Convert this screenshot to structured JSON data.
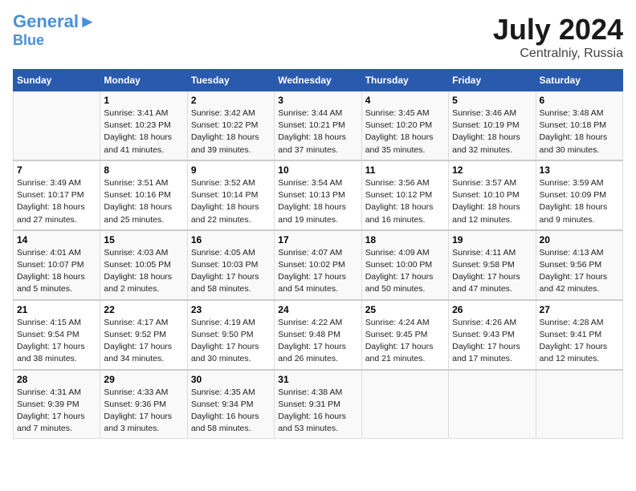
{
  "header": {
    "logo_line1": "General",
    "logo_line2": "Blue",
    "month_year": "July 2024",
    "location": "Centralniy, Russia"
  },
  "days_of_week": [
    "Sunday",
    "Monday",
    "Tuesday",
    "Wednesday",
    "Thursday",
    "Friday",
    "Saturday"
  ],
  "weeks": [
    [
      {
        "day": "",
        "info": ""
      },
      {
        "day": "1",
        "info": "Sunrise: 3:41 AM\nSunset: 10:23 PM\nDaylight: 18 hours\nand 41 minutes."
      },
      {
        "day": "2",
        "info": "Sunrise: 3:42 AM\nSunset: 10:22 PM\nDaylight: 18 hours\nand 39 minutes."
      },
      {
        "day": "3",
        "info": "Sunrise: 3:44 AM\nSunset: 10:21 PM\nDaylight: 18 hours\nand 37 minutes."
      },
      {
        "day": "4",
        "info": "Sunrise: 3:45 AM\nSunset: 10:20 PM\nDaylight: 18 hours\nand 35 minutes."
      },
      {
        "day": "5",
        "info": "Sunrise: 3:46 AM\nSunset: 10:19 PM\nDaylight: 18 hours\nand 32 minutes."
      },
      {
        "day": "6",
        "info": "Sunrise: 3:48 AM\nSunset: 10:18 PM\nDaylight: 18 hours\nand 30 minutes."
      }
    ],
    [
      {
        "day": "7",
        "info": "Sunrise: 3:49 AM\nSunset: 10:17 PM\nDaylight: 18 hours\nand 27 minutes."
      },
      {
        "day": "8",
        "info": "Sunrise: 3:51 AM\nSunset: 10:16 PM\nDaylight: 18 hours\nand 25 minutes."
      },
      {
        "day": "9",
        "info": "Sunrise: 3:52 AM\nSunset: 10:14 PM\nDaylight: 18 hours\nand 22 minutes."
      },
      {
        "day": "10",
        "info": "Sunrise: 3:54 AM\nSunset: 10:13 PM\nDaylight: 18 hours\nand 19 minutes."
      },
      {
        "day": "11",
        "info": "Sunrise: 3:56 AM\nSunset: 10:12 PM\nDaylight: 18 hours\nand 16 minutes."
      },
      {
        "day": "12",
        "info": "Sunrise: 3:57 AM\nSunset: 10:10 PM\nDaylight: 18 hours\nand 12 minutes."
      },
      {
        "day": "13",
        "info": "Sunrise: 3:59 AM\nSunset: 10:09 PM\nDaylight: 18 hours\nand 9 minutes."
      }
    ],
    [
      {
        "day": "14",
        "info": "Sunrise: 4:01 AM\nSunset: 10:07 PM\nDaylight: 18 hours\nand 5 minutes."
      },
      {
        "day": "15",
        "info": "Sunrise: 4:03 AM\nSunset: 10:05 PM\nDaylight: 18 hours\nand 2 minutes."
      },
      {
        "day": "16",
        "info": "Sunrise: 4:05 AM\nSunset: 10:03 PM\nDaylight: 17 hours\nand 58 minutes."
      },
      {
        "day": "17",
        "info": "Sunrise: 4:07 AM\nSunset: 10:02 PM\nDaylight: 17 hours\nand 54 minutes."
      },
      {
        "day": "18",
        "info": "Sunrise: 4:09 AM\nSunset: 10:00 PM\nDaylight: 17 hours\nand 50 minutes."
      },
      {
        "day": "19",
        "info": "Sunrise: 4:11 AM\nSunset: 9:58 PM\nDaylight: 17 hours\nand 47 minutes."
      },
      {
        "day": "20",
        "info": "Sunrise: 4:13 AM\nSunset: 9:56 PM\nDaylight: 17 hours\nand 42 minutes."
      }
    ],
    [
      {
        "day": "21",
        "info": "Sunrise: 4:15 AM\nSunset: 9:54 PM\nDaylight: 17 hours\nand 38 minutes."
      },
      {
        "day": "22",
        "info": "Sunrise: 4:17 AM\nSunset: 9:52 PM\nDaylight: 17 hours\nand 34 minutes."
      },
      {
        "day": "23",
        "info": "Sunrise: 4:19 AM\nSunset: 9:50 PM\nDaylight: 17 hours\nand 30 minutes."
      },
      {
        "day": "24",
        "info": "Sunrise: 4:22 AM\nSunset: 9:48 PM\nDaylight: 17 hours\nand 26 minutes."
      },
      {
        "day": "25",
        "info": "Sunrise: 4:24 AM\nSunset: 9:45 PM\nDaylight: 17 hours\nand 21 minutes."
      },
      {
        "day": "26",
        "info": "Sunrise: 4:26 AM\nSunset: 9:43 PM\nDaylight: 17 hours\nand 17 minutes."
      },
      {
        "day": "27",
        "info": "Sunrise: 4:28 AM\nSunset: 9:41 PM\nDaylight: 17 hours\nand 12 minutes."
      }
    ],
    [
      {
        "day": "28",
        "info": "Sunrise: 4:31 AM\nSunset: 9:39 PM\nDaylight: 17 hours\nand 7 minutes."
      },
      {
        "day": "29",
        "info": "Sunrise: 4:33 AM\nSunset: 9:36 PM\nDaylight: 17 hours\nand 3 minutes."
      },
      {
        "day": "30",
        "info": "Sunrise: 4:35 AM\nSunset: 9:34 PM\nDaylight: 16 hours\nand 58 minutes."
      },
      {
        "day": "31",
        "info": "Sunrise: 4:38 AM\nSunset: 9:31 PM\nDaylight: 16 hours\nand 53 minutes."
      },
      {
        "day": "",
        "info": ""
      },
      {
        "day": "",
        "info": ""
      },
      {
        "day": "",
        "info": ""
      }
    ]
  ]
}
